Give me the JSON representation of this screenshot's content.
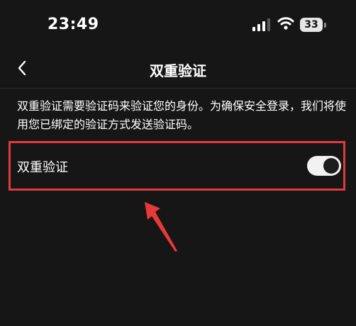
{
  "status_bar": {
    "time": "23:49",
    "battery_level": "33",
    "icons": [
      "signal-icon",
      "wifi-icon",
      "battery-icon"
    ]
  },
  "nav": {
    "title": "双重验证",
    "back_icon": "chevron-left-icon"
  },
  "description": "双重验证需要验证码来验证您的身份。为确保安全登录，我们将使用您已绑定的验证方式发送验证码。",
  "setting": {
    "label": "双重验证",
    "toggle_on": true
  },
  "annotation": {
    "highlight_color": "#e23a3a",
    "arrow_icon": "red-arrow-icon"
  },
  "colors": {
    "background": "#161616",
    "text": "#ffffff",
    "toggle_track": "#f2f2f2",
    "toggle_knob": "#1d1d1d"
  }
}
